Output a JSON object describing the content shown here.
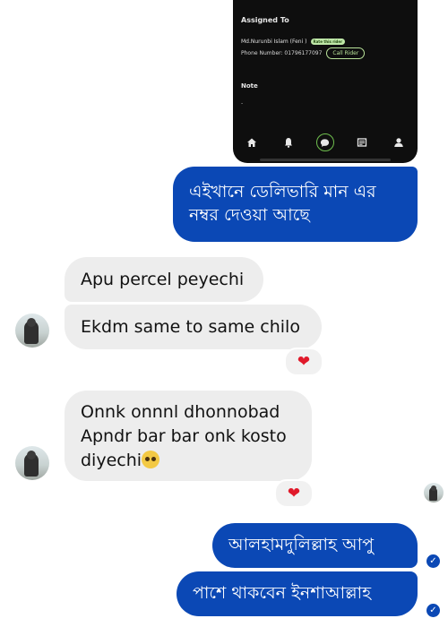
{
  "screenshot": {
    "assigned_to_label": "Assigned To",
    "rider_name": "Md.Nurunbi Islam (Feni )",
    "rate_rider_label": "Rate this rider",
    "phone_text": "Phone Number: 01796177097",
    "call_rider_label": "Call Rider",
    "note_label": "Note",
    "note_value": "-",
    "nav_icons": [
      "home-icon",
      "bell-icon",
      "chat-icon",
      "receipt-icon",
      "profile-icon"
    ]
  },
  "messages": [
    {
      "direction": "outgoing",
      "text": "এইখানে ডেলিভারি মান এর নম্বর দেওয়া আছে"
    },
    {
      "direction": "incoming",
      "text": "Apu percel peyechi"
    },
    {
      "direction": "incoming",
      "text": "Ekdm same to same chilo",
      "reaction": "❤"
    },
    {
      "direction": "incoming",
      "line1": "Onnk onnnl dhonnobad",
      "line2": "Apndr bar bar onk kosto",
      "line3": "diyechi",
      "reaction": "❤"
    },
    {
      "direction": "outgoing",
      "text": "আলহামদুলিল্লাহ আপু"
    },
    {
      "direction": "outgoing",
      "text": "পাশে থাকবেন ইনশাআল্লাহ"
    }
  ],
  "receipt_glyph": "✓",
  "colors": {
    "outgoing_bubble": "#0b48b5",
    "incoming_bubble": "#ededed",
    "reaction_heart": "#e0192a",
    "screenshot_bg": "#0e0e0e",
    "call_button": "#b9e39a"
  }
}
